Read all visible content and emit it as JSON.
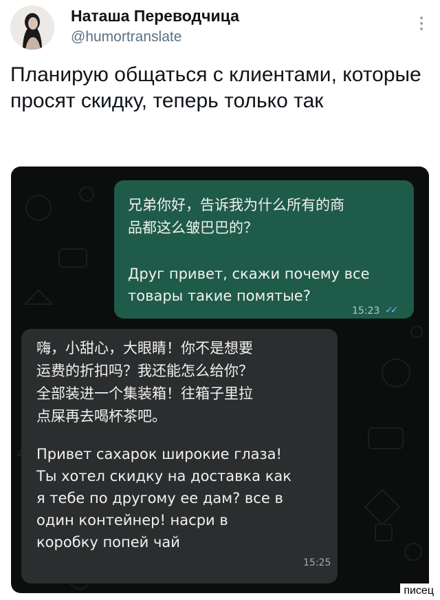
{
  "tweet": {
    "author_name": "Наташа Переводчица",
    "handle": "@humortranslate",
    "text": "Планирую общаться с клиентами, которые просят скидку, теперь только так"
  },
  "icons": {
    "avatar": "user-avatar",
    "more": "more-options-icon",
    "read_receipt": "double-check-icon"
  },
  "chat": {
    "outgoing": {
      "text_cn": "兄弟你好，告诉我为什么所有的商\n品都这么皱巴巴的？",
      "text_ru": "Друг привет, скажи почему все\nтовары такие помятые?",
      "time": "15:23",
      "ticks": "✓✓"
    },
    "incoming": {
      "text_cn": "嗨，小甜心，大眼睛！你不是想要\n运费的折扣吗？我还能怎么给你？\n全部装进一个集装箱！往箱子里拉\n点屎再去喝杯茶吧。",
      "text_ru": "Привет сахарок широкие глаза!\nТы хотел скидку на доставка как\nя тебе по другому ее дам? все в\nодин контейнер! насри в\nкоробку попей чай",
      "time": "15:25"
    }
  },
  "watermark": "писец",
  "colors": {
    "outgoing_bubble": "#1f5b49",
    "incoming_bubble": "#2b2d2e",
    "chat_background": "#0c0d0d",
    "handle": "#5b7083"
  }
}
